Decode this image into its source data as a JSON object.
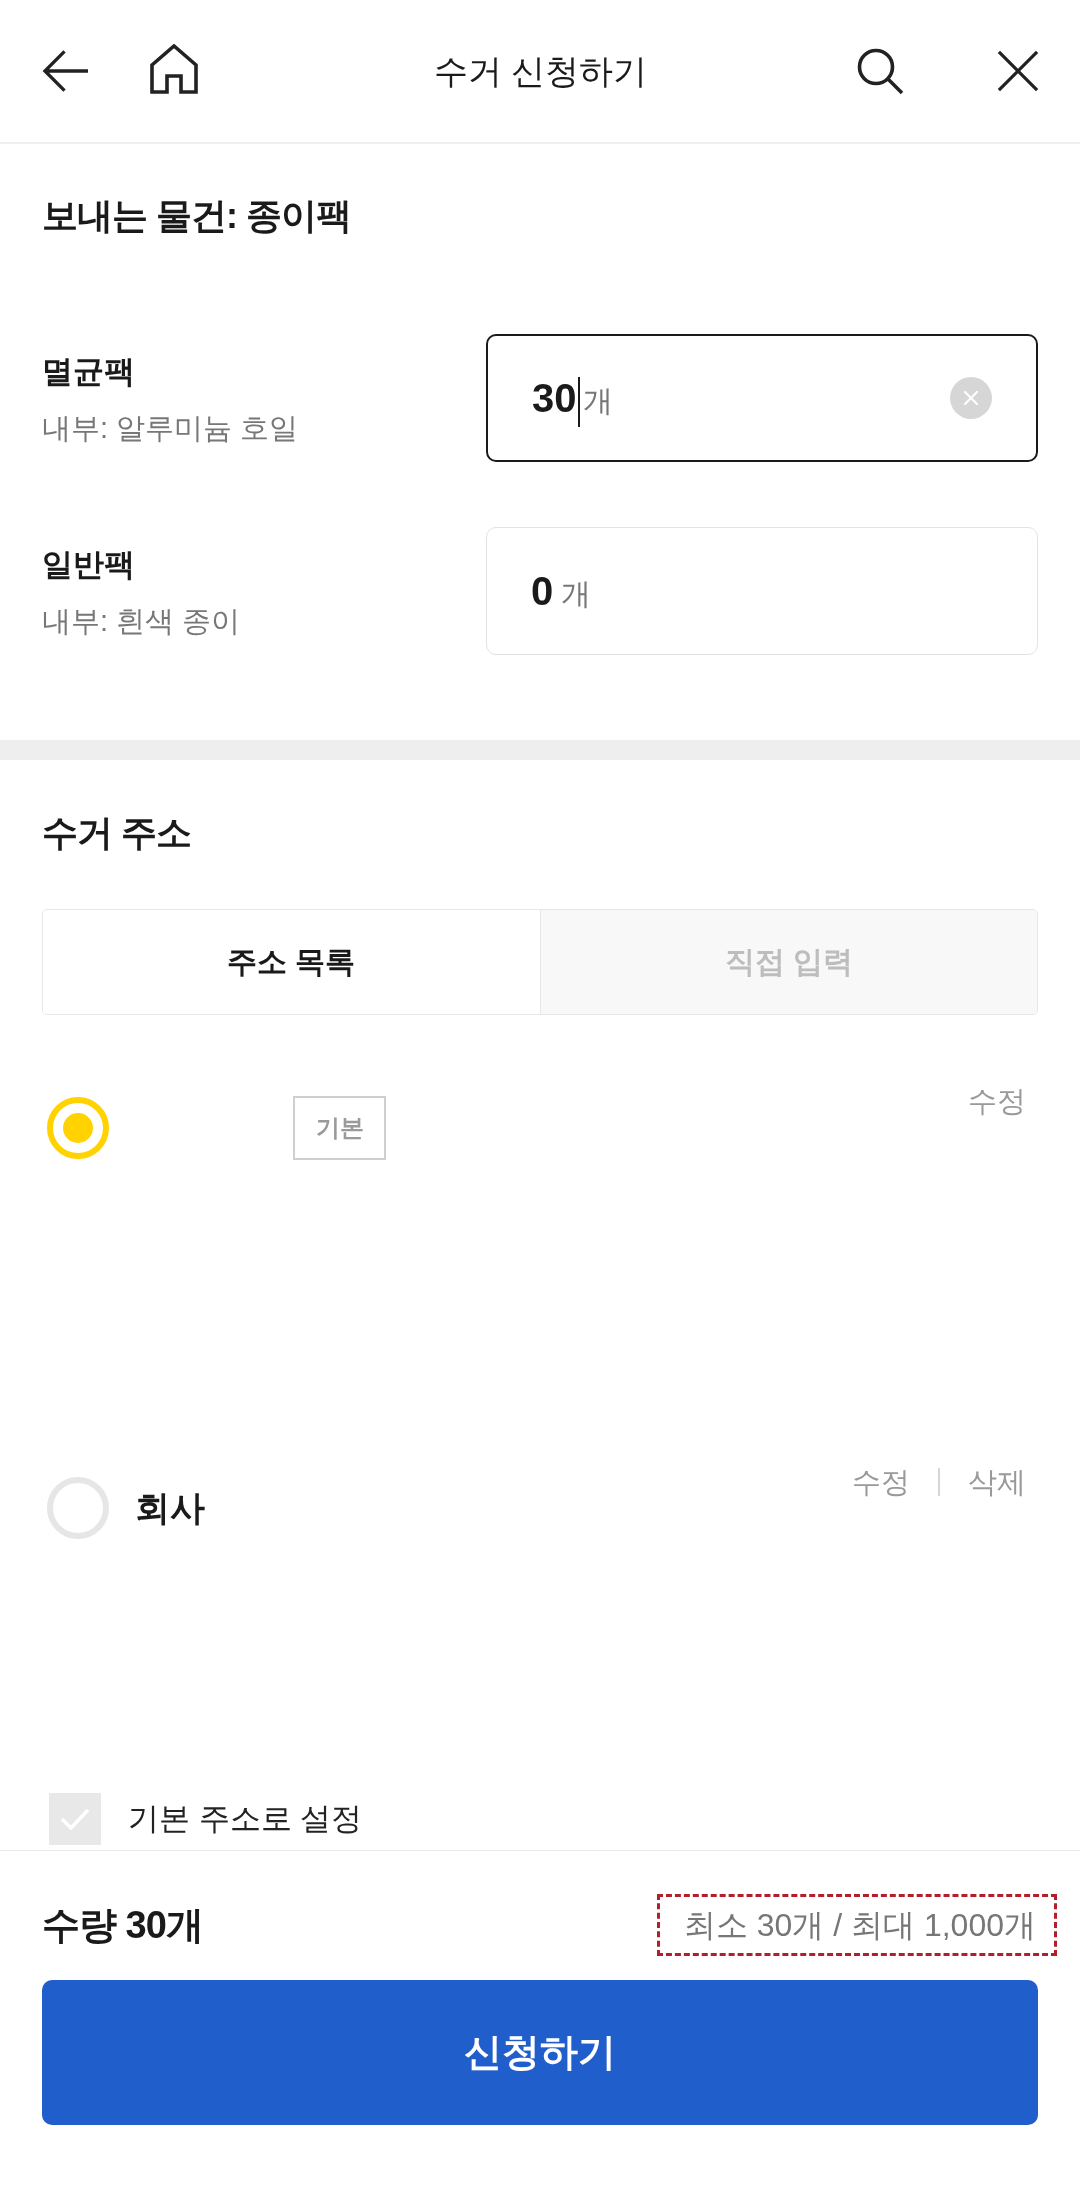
{
  "header": {
    "title": "수거 신청하기"
  },
  "items_section": {
    "title": "보내는 물건: 종이팩",
    "items": [
      {
        "name": "멸균팩",
        "description": "내부: 알루미늄 호일",
        "value": "30",
        "unit": "개",
        "focused": true
      },
      {
        "name": "일반팩",
        "description": "내부: 흰색 종이",
        "value": "0",
        "unit": "개",
        "focused": false
      }
    ]
  },
  "address_section": {
    "title": "수거 주소",
    "tabs": [
      {
        "label": "주소 목록",
        "selected": true
      },
      {
        "label": "직접 입력",
        "selected": false
      }
    ],
    "addresses": [
      {
        "badge": "기본",
        "selected": true,
        "actions": [
          "수정"
        ]
      },
      {
        "name": "회사",
        "selected": false,
        "actions": [
          "수정",
          "삭제"
        ]
      }
    ],
    "default_option": {
      "label": "기본 주소로 설정",
      "checked": false
    }
  },
  "summary": {
    "quantity": "수량 30개",
    "limit": "최소 30개 / 최대 1,000개",
    "highlighted": true
  },
  "submit_button": {
    "label": "신청하기"
  }
}
